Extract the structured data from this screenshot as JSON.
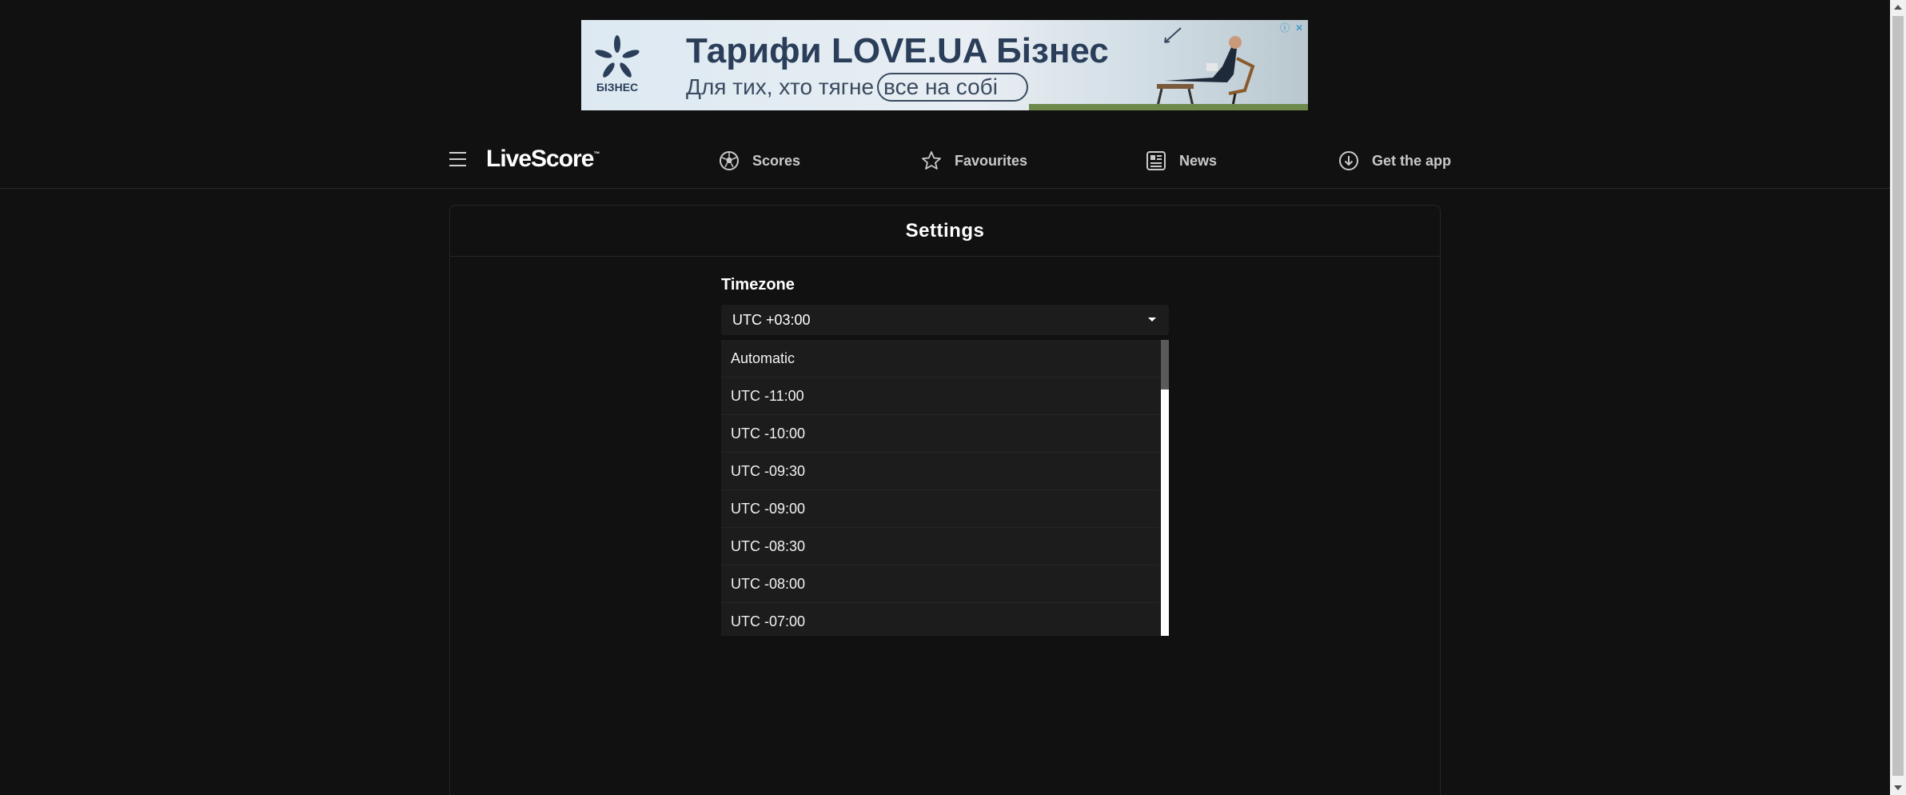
{
  "ad": {
    "brand": "БІЗНЕС",
    "title": "Тарифи LOVE.UA Бізнес",
    "subtitle_prefix": "Для тих, хто тягне",
    "subtitle_pill": "все на собі"
  },
  "header": {
    "logo": "LiveScore",
    "logo_tm": "™",
    "nav": {
      "scores": "Scores",
      "favourites": "Favourites",
      "news": "News",
      "get_app": "Get the app"
    }
  },
  "settings": {
    "title": "Settings",
    "timezone_label": "Timezone",
    "selected": "UTC +03:00",
    "options": [
      "Automatic",
      "UTC -11:00",
      "UTC -10:00",
      "UTC -09:30",
      "UTC -09:00",
      "UTC -08:30",
      "UTC -08:00",
      "UTC -07:00"
    ]
  },
  "colors": {
    "background": "#111111",
    "dropdown": "#1c1c1c",
    "ad_text": "#2a3e5a"
  }
}
